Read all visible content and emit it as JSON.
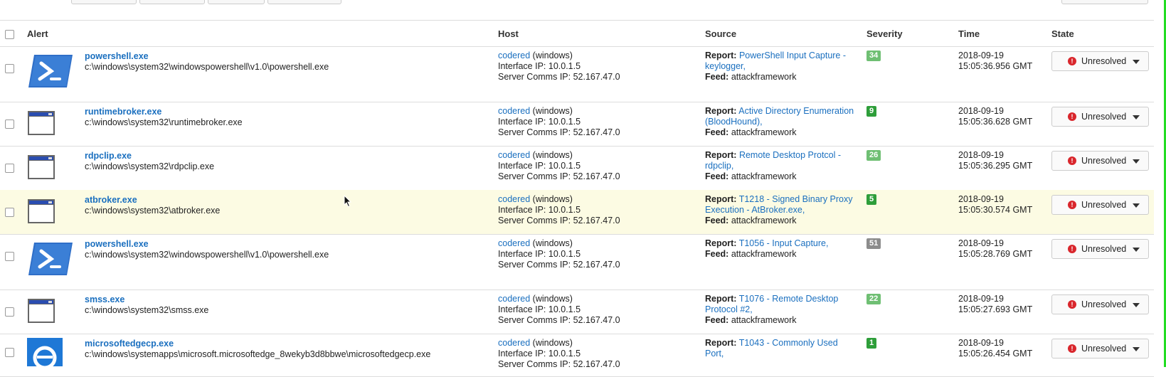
{
  "columns": {
    "alert": "Alert",
    "host": "Host",
    "source": "Source",
    "severity": "Severity",
    "time": "Time",
    "state": "State"
  },
  "labels": {
    "report": "Report:",
    "feed": "Feed:"
  },
  "rows": [
    {
      "icon": "powershell-icon",
      "name": "powershell.exe",
      "path": "c:\\windows\\system32\\windowspowershell\\v1.0\\powershell.exe",
      "host_name": "codered",
      "host_os": " (windows)",
      "interface_ip": "Interface IP: 10.0.1.5",
      "server_ip": "Server Comms IP: 52.167.47.0",
      "report": "PowerShell Input Capture - keylogger,",
      "feed": "attackframework",
      "severity": "34",
      "severity_color": "#6fbf73",
      "date": "2018-09-19",
      "time": "15:05:36.956 GMT",
      "state": "Unresolved"
    },
    {
      "icon": "window-icon",
      "name": "runtimebroker.exe",
      "path": "c:\\windows\\system32\\runtimebroker.exe",
      "host_name": "codered",
      "host_os": " (windows)",
      "interface_ip": "Interface IP: 10.0.1.5",
      "server_ip": "Server Comms IP: 52.167.47.0",
      "report": "Active Directory Enumeration (BloodHound),",
      "feed": "attackframework",
      "severity": "9",
      "severity_color": "#2e9e3a",
      "date": "2018-09-19",
      "time": "15:05:36.628 GMT",
      "state": "Unresolved"
    },
    {
      "icon": "window-icon",
      "name": "rdpclip.exe",
      "path": "c:\\windows\\system32\\rdpclip.exe",
      "host_name": "codered",
      "host_os": " (windows)",
      "interface_ip": "Interface IP: 10.0.1.5",
      "server_ip": "Server Comms IP: 52.167.47.0",
      "report": "Remote Desktop Protcol - rdpclip,",
      "feed": "attackframework",
      "severity": "26",
      "severity_color": "#6fbf73",
      "date": "2018-09-19",
      "time": "15:05:36.295 GMT",
      "state": "Unresolved"
    },
    {
      "icon": "window-icon",
      "name": "atbroker.exe",
      "path": "c:\\windows\\system32\\atbroker.exe",
      "host_name": "codered",
      "host_os": " (windows)",
      "interface_ip": "Interface IP: 10.0.1.5",
      "server_ip": "Server Comms IP: 52.167.47.0",
      "report": "T1218 - Signed Binary Proxy Execution - AtBroker.exe,",
      "feed": "attackframework",
      "severity": "5",
      "severity_color": "#2e9e3a",
      "date": "2018-09-19",
      "time": "15:05:30.574 GMT",
      "state": "Unresolved"
    },
    {
      "icon": "powershell-icon",
      "name": "powershell.exe",
      "path": "c:\\windows\\system32\\windowspowershell\\v1.0\\powershell.exe",
      "host_name": "codered",
      "host_os": " (windows)",
      "interface_ip": "Interface IP: 10.0.1.5",
      "server_ip": "Server Comms IP: 52.167.47.0",
      "report": "T1056 - Input Capture,",
      "feed": "attackframework",
      "severity": "51",
      "severity_color": "#8c8c8c",
      "date": "2018-09-19",
      "time": "15:05:28.769 GMT",
      "state": "Unresolved"
    },
    {
      "icon": "window-icon",
      "name": "smss.exe",
      "path": "c:\\windows\\system32\\smss.exe",
      "host_name": "codered",
      "host_os": " (windows)",
      "interface_ip": "Interface IP: 10.0.1.5",
      "server_ip": "Server Comms IP: 52.167.47.0",
      "report": "T1076 - Remote Desktop Protocol #2,",
      "feed": "attackframework",
      "severity": "22",
      "severity_color": "#6fbf73",
      "date": "2018-09-19",
      "time": "15:05:27.693 GMT",
      "state": "Unresolved"
    },
    {
      "icon": "edge-icon",
      "name": "microsoftedgecp.exe",
      "path": "c:\\windows\\systemapps\\microsoft.microsoftedge_8wekyb3d8bbwe\\microsoftedgecp.exe",
      "host_name": "codered",
      "host_os": " (windows)",
      "interface_ip": "Interface IP: 10.0.1.5",
      "server_ip": "Server Comms IP: 52.167.47.0",
      "report": "T1043 - Commonly Used Port,",
      "feed": "",
      "severity": "1",
      "severity_color": "#2e9e3a",
      "date": "2018-09-19",
      "time": "15:05:26.454 GMT",
      "state": "Unresolved"
    }
  ]
}
